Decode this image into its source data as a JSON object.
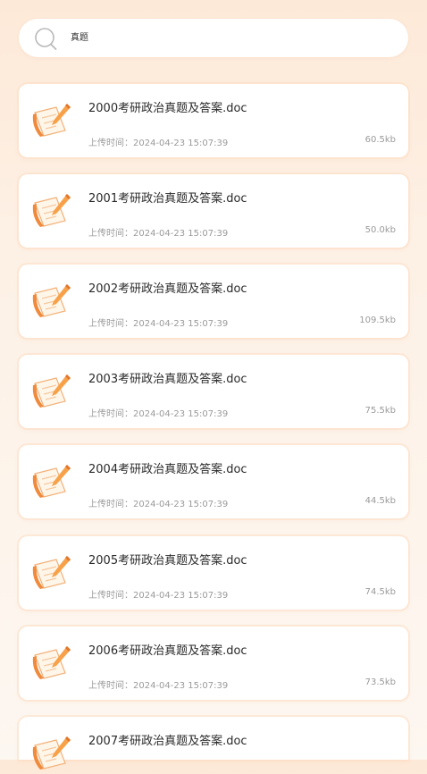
{
  "search": {
    "value": "真题",
    "icon": "search-icon"
  },
  "files": [
    {
      "name": "2000考研政治真题及答案.doc",
      "time": "上传时间：2024-04-23 15:07:39",
      "size": "60.5kb",
      "icon": "notebook-pencil-icon"
    },
    {
      "name": "2001考研政治真题及答案.doc",
      "time": "上传时间：2024-04-23 15:07:39",
      "size": "50.0kb",
      "icon": "notebook-pencil-icon"
    },
    {
      "name": "2002考研政治真题及答案.doc",
      "time": "上传时间：2024-04-23 15:07:39",
      "size": "109.5kb",
      "icon": "notebook-pencil-icon"
    },
    {
      "name": "2003考研政治真题及答案.doc",
      "time": "上传时间：2024-04-23 15:07:39",
      "size": "75.5kb",
      "icon": "notebook-pencil-icon"
    },
    {
      "name": "2004考研政治真题及答案.doc",
      "time": "上传时间：2024-04-23 15:07:39",
      "size": "44.5kb",
      "icon": "notebook-pencil-icon"
    },
    {
      "name": "2005考研政治真题及答案.doc",
      "time": "上传时间：2024-04-23 15:07:39",
      "size": "74.5kb",
      "icon": "notebook-pencil-icon"
    },
    {
      "name": "2006考研政治真题及答案.doc",
      "time": "上传时间：2024-04-23 15:07:39",
      "size": "73.5kb",
      "icon": "notebook-pencil-icon"
    },
    {
      "name": "2007考研政治真题及答案.doc",
      "time": "",
      "size": "",
      "icon": "notebook-pencil-icon"
    }
  ],
  "colors": {
    "accent_orange": "#f08a3c",
    "card_border": "#fde0c8",
    "text_primary": "#2a2a2a",
    "text_secondary": "#9a9a9a"
  }
}
